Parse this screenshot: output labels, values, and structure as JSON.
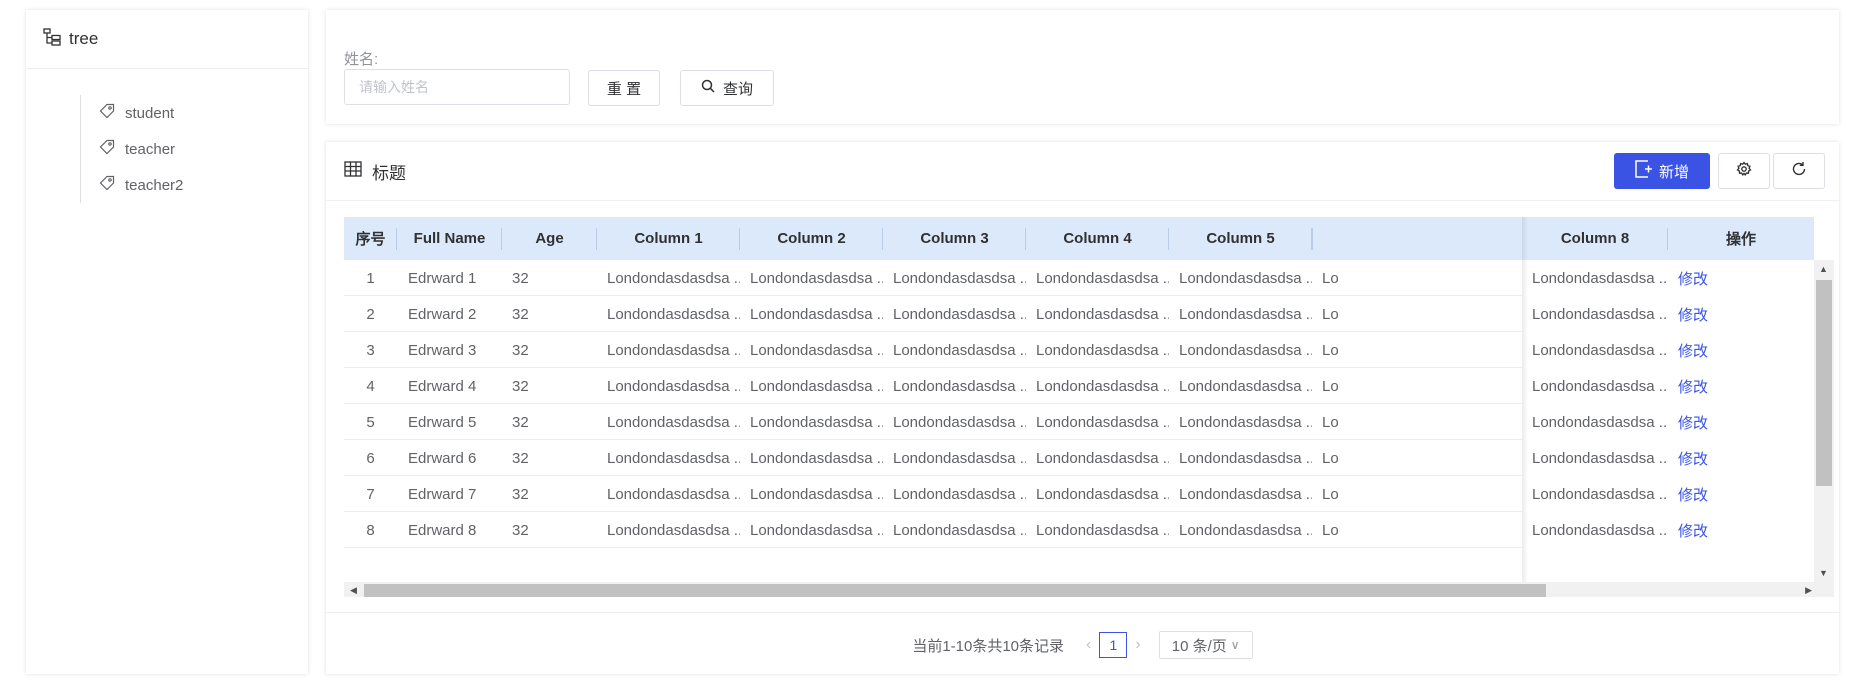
{
  "tree": {
    "title": "tree",
    "icon": "tree-structure-icon",
    "items": [
      {
        "label": "student",
        "icon": "tag-icon"
      },
      {
        "label": "teacher",
        "icon": "tag-icon"
      },
      {
        "label": "teacher2",
        "icon": "tag-icon"
      }
    ]
  },
  "search": {
    "label": "姓名:",
    "placeholder": "请输入姓名",
    "reset_label": "重 置",
    "query_label": "查询"
  },
  "table": {
    "title": "标题",
    "add_label": "新增",
    "columns": [
      "序号",
      "Full Name",
      "Age",
      "Column 1",
      "Column 2",
      "Column 3",
      "Column 4",
      "Column 5",
      "Column 8",
      "操作"
    ],
    "rows": [
      {
        "index": "1",
        "name": "Edrward 1",
        "age": "32",
        "c1": "Londondasdasdsa ...",
        "c2": "Londondasdasdsa ...",
        "c3": "Londondasdasdsa ...",
        "c4": "Londondasdasdsa ...",
        "c5": "Londondasdasdsa ...",
        "c6": "Lo",
        "c8": "Londondasdasdsa ...",
        "action": "修改"
      },
      {
        "index": "2",
        "name": "Edrward 2",
        "age": "32",
        "c1": "Londondasdasdsa ...",
        "c2": "Londondasdasdsa ...",
        "c3": "Londondasdasdsa ...",
        "c4": "Londondasdasdsa ...",
        "c5": "Londondasdasdsa ...",
        "c6": "Lo",
        "c8": "Londondasdasdsa ...",
        "action": "修改"
      },
      {
        "index": "3",
        "name": "Edrward 3",
        "age": "32",
        "c1": "Londondasdasdsa ...",
        "c2": "Londondasdasdsa ...",
        "c3": "Londondasdasdsa ...",
        "c4": "Londondasdasdsa ...",
        "c5": "Londondasdasdsa ...",
        "c6": "Lo",
        "c8": "Londondasdasdsa ...",
        "action": "修改"
      },
      {
        "index": "4",
        "name": "Edrward 4",
        "age": "32",
        "c1": "Londondasdasdsa ...",
        "c2": "Londondasdasdsa ...",
        "c3": "Londondasdasdsa ...",
        "c4": "Londondasdasdsa ...",
        "c5": "Londondasdasdsa ...",
        "c6": "Lo",
        "c8": "Londondasdasdsa ...",
        "action": "修改"
      },
      {
        "index": "5",
        "name": "Edrward 5",
        "age": "32",
        "c1": "Londondasdasdsa ...",
        "c2": "Londondasdasdsa ...",
        "c3": "Londondasdasdsa ...",
        "c4": "Londondasdasdsa ...",
        "c5": "Londondasdasdsa ...",
        "c6": "Lo",
        "c8": "Londondasdasdsa ...",
        "action": "修改"
      },
      {
        "index": "6",
        "name": "Edrward 6",
        "age": "32",
        "c1": "Londondasdasdsa ...",
        "c2": "Londondasdasdsa ...",
        "c3": "Londondasdasdsa ...",
        "c4": "Londondasdasdsa ...",
        "c5": "Londondasdasdsa ...",
        "c6": "Lo",
        "c8": "Londondasdasdsa ...",
        "action": "修改"
      },
      {
        "index": "7",
        "name": "Edrward 7",
        "age": "32",
        "c1": "Londondasdasdsa ...",
        "c2": "Londondasdasdsa ...",
        "c3": "Londondasdasdsa ...",
        "c4": "Londondasdasdsa ...",
        "c5": "Londondasdasdsa ...",
        "c6": "Lo",
        "c8": "Londondasdasdsa ...",
        "action": "修改"
      },
      {
        "index": "8",
        "name": "Edrward 8",
        "age": "32",
        "c1": "Londondasdasdsa ...",
        "c2": "Londondasdasdsa ...",
        "c3": "Londondasdasdsa ...",
        "c4": "Londondasdasdsa ...",
        "c5": "Londondasdasdsa ...",
        "c6": "Lo",
        "c8": "Londondasdasdsa ...",
        "action": "修改"
      }
    ]
  },
  "pagination": {
    "total_text": "当前1-10条共10条记录",
    "current_page": "1",
    "page_size": "10 条/页"
  },
  "colors": {
    "primary": "#3a53e4",
    "header_bg": "#dbe9fb"
  }
}
